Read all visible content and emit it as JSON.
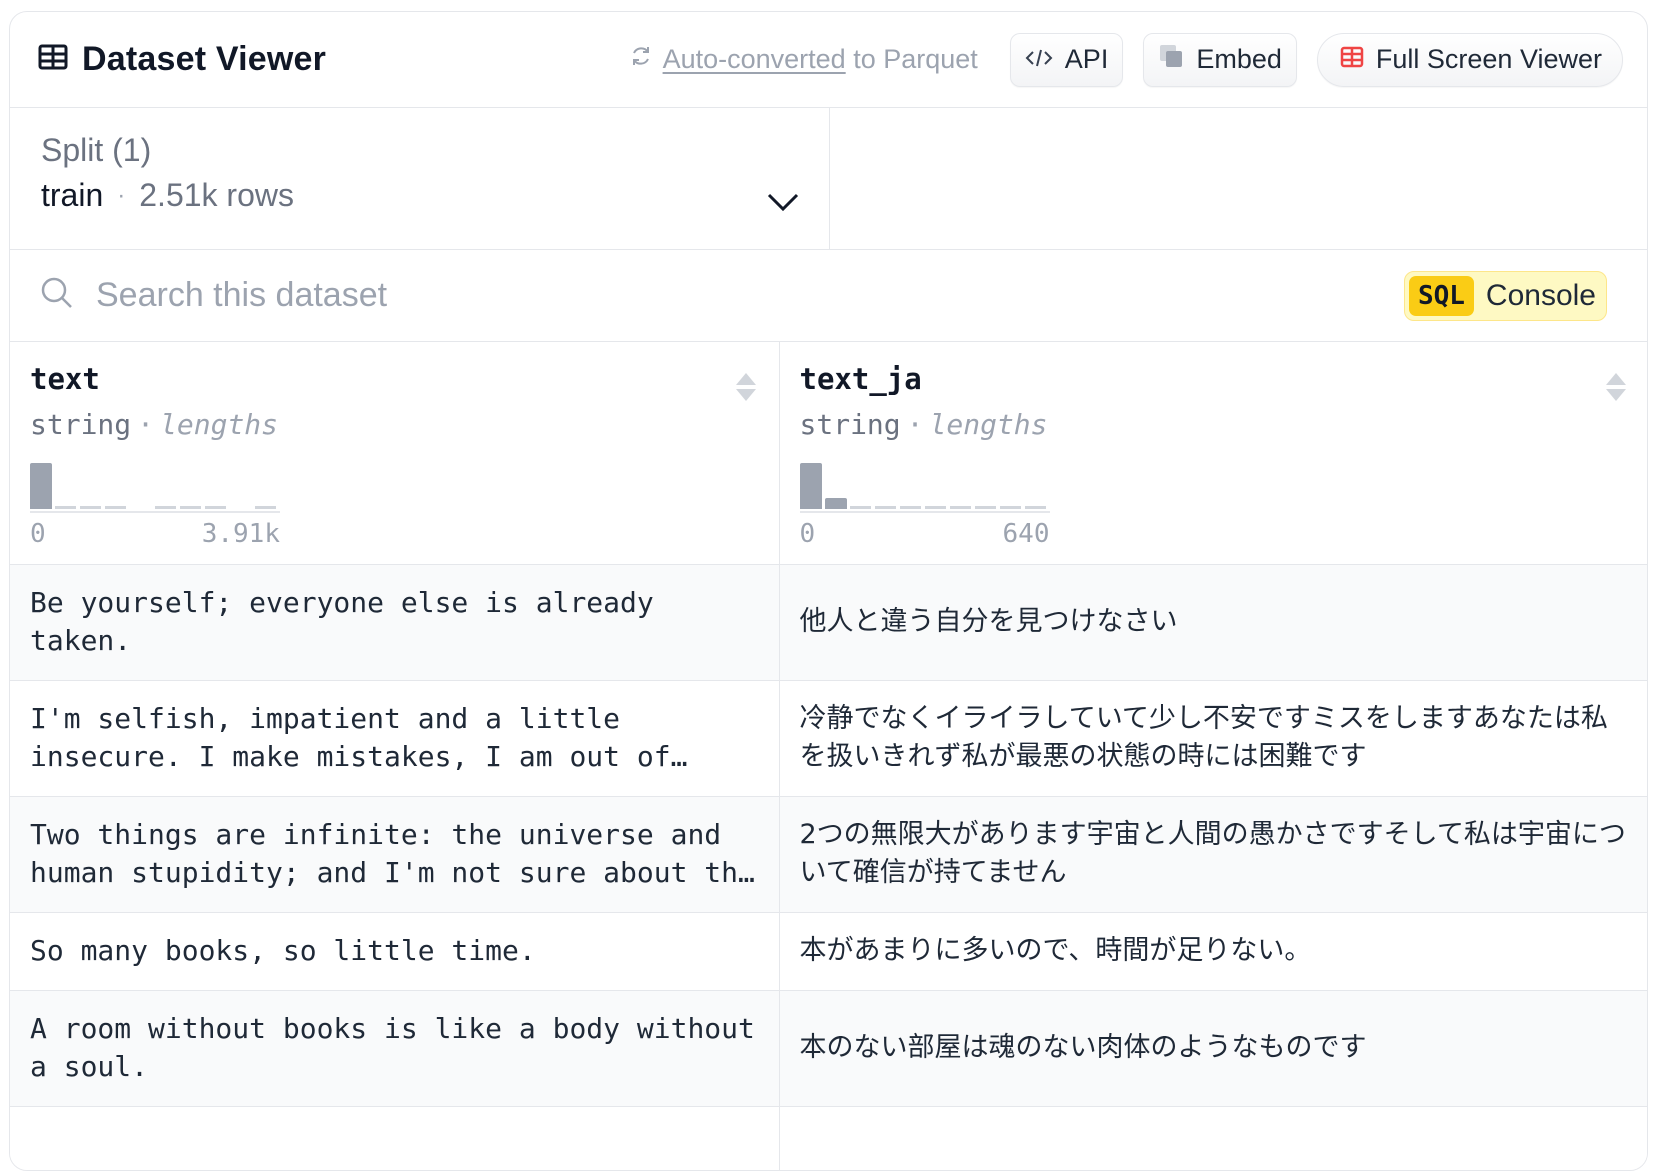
{
  "header": {
    "title": "Dataset Viewer",
    "parquet_link": "Auto-converted",
    "parquet_rest": "to Parquet",
    "api_label": "API",
    "embed_label": "Embed",
    "fullscreen_label": "Full Screen Viewer"
  },
  "split": {
    "label": "Split (1)",
    "name": "train",
    "separator": "·",
    "rows": "2.51k rows"
  },
  "search": {
    "placeholder": "Search this dataset"
  },
  "sql": {
    "tag": "SQL",
    "label": "Console"
  },
  "columns": [
    {
      "name": "text",
      "type": "string",
      "separator": "·",
      "stat": "lengths",
      "hist_min": "0",
      "hist_max": "3.91k",
      "hist_values": [
        0.95,
        0.03,
        0.03,
        0.03,
        0,
        0.03,
        0.03,
        0.03,
        0,
        0.03
      ]
    },
    {
      "name": "text_ja",
      "type": "string",
      "separator": "·",
      "stat": "lengths",
      "hist_min": "0",
      "hist_max": "640",
      "hist_values": [
        0.95,
        0.22,
        0.03,
        0.03,
        0.03,
        0.03,
        0.03,
        0.03,
        0.03,
        0.03
      ]
    }
  ],
  "rows": [
    {
      "text": "Be yourself; everyone else is already taken.",
      "text_ja": "他人と違う自分を見つけなさい"
    },
    {
      "text": "I'm selfish, impatient and a little insecure. I make mistakes, I am out of control and at times hard to handle.",
      "text_ja": "冷静でなくイライラしていて少し不安ですミスをしますあなたは私を扱いきれず私が最悪の状態の時には困難です"
    },
    {
      "text": "Two things are infinite: the universe and human stupidity; and I'm not sure about the universe.",
      "text_ja": "2つの無限大があります宇宙と人間の愚かさですそして私は宇宙について確信が持てません"
    },
    {
      "text": "So many books, so little time.",
      "text_ja": "本があまりに多いので、時間が足りない。"
    },
    {
      "text": "A room without books is like a body without a soul.",
      "text_ja": "本のない部屋は魂のない肉体のようなものです"
    }
  ],
  "colors": {
    "accent_red": "#ef4444",
    "sql_yellow": "#facc15",
    "border": "#e5e7eb"
  },
  "icons": {
    "title": "table-icon",
    "parquet": "refresh-icon",
    "api": "code-icon",
    "embed": "copy-icon",
    "fullscreen": "table-red-icon",
    "search": "search-icon",
    "split": "chevron-down-icon",
    "sort": "sort-icon"
  }
}
